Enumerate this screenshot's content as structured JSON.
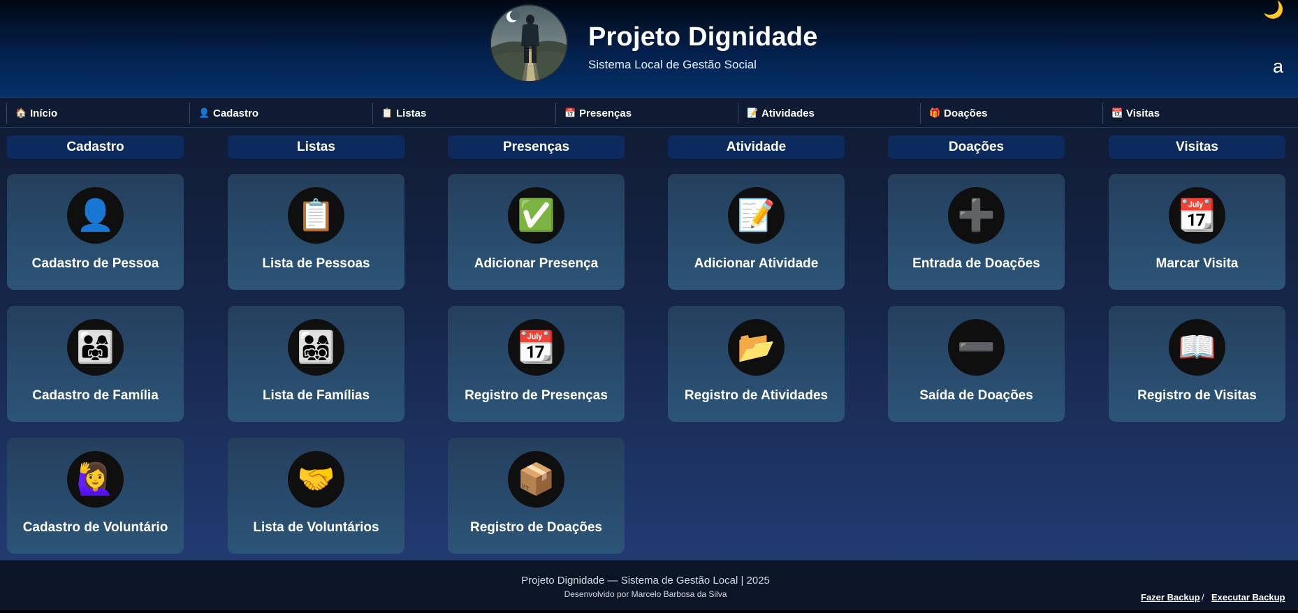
{
  "header": {
    "title": "Projeto Dignidade",
    "subtitle": "Sistema Local de Gestão Social",
    "theme_icon": "moon-icon",
    "user_initial": "a"
  },
  "nav": [
    {
      "label": "Início",
      "icon": "🏠"
    },
    {
      "label": "Cadastro",
      "icon": "👤"
    },
    {
      "label": "Listas",
      "icon": "📋"
    },
    {
      "label": "Presenças",
      "icon": "📅"
    },
    {
      "label": "Atividades",
      "icon": "📝"
    },
    {
      "label": "Doações",
      "icon": "🎁"
    },
    {
      "label": "Visitas",
      "icon": "📆"
    }
  ],
  "columns": [
    {
      "title": "Cadastro",
      "cards": [
        {
          "label": "Cadastro de Pessoa",
          "icon": "👤"
        },
        {
          "label": "Cadastro de Família",
          "icon": "👨‍👩‍👧"
        },
        {
          "label": "Cadastro de Voluntário",
          "icon": "🙋‍♀️"
        }
      ]
    },
    {
      "title": "Listas",
      "cards": [
        {
          "label": "Lista de Pessoas",
          "icon": "📋"
        },
        {
          "label": "Lista de Famílias",
          "icon": "👨‍👩‍👧‍👦"
        },
        {
          "label": "Lista de Voluntários",
          "icon": "🤝"
        }
      ]
    },
    {
      "title": "Presenças",
      "cards": [
        {
          "label": "Adicionar Presença",
          "icon": "✅"
        },
        {
          "label": "Registro de Presenças",
          "icon": "📆"
        },
        {
          "label": "Registro de Doações",
          "icon": "📦"
        }
      ]
    },
    {
      "title": "Atividade",
      "cards": [
        {
          "label": "Adicionar Atividade",
          "icon": "📝"
        },
        {
          "label": "Registro de Atividades",
          "icon": "📂"
        }
      ]
    },
    {
      "title": "Doações",
      "cards": [
        {
          "label": "Entrada de Doações",
          "icon": "➕"
        },
        {
          "label": "Saída de Doações",
          "icon": "➖"
        }
      ]
    },
    {
      "title": "Visitas",
      "cards": [
        {
          "label": "Marcar Visita",
          "icon": "📆"
        },
        {
          "label": "Registro de Visitas",
          "icon": "📖"
        }
      ]
    }
  ],
  "footer": {
    "main": "Projeto Dignidade — Sistema de Gestão Local | 2025",
    "dev": "Desenvolvido por Marcelo Barbosa da Silva",
    "backup_make": "Fazer Backup",
    "backup_sep": "/",
    "backup_run": "Executar Backup"
  }
}
